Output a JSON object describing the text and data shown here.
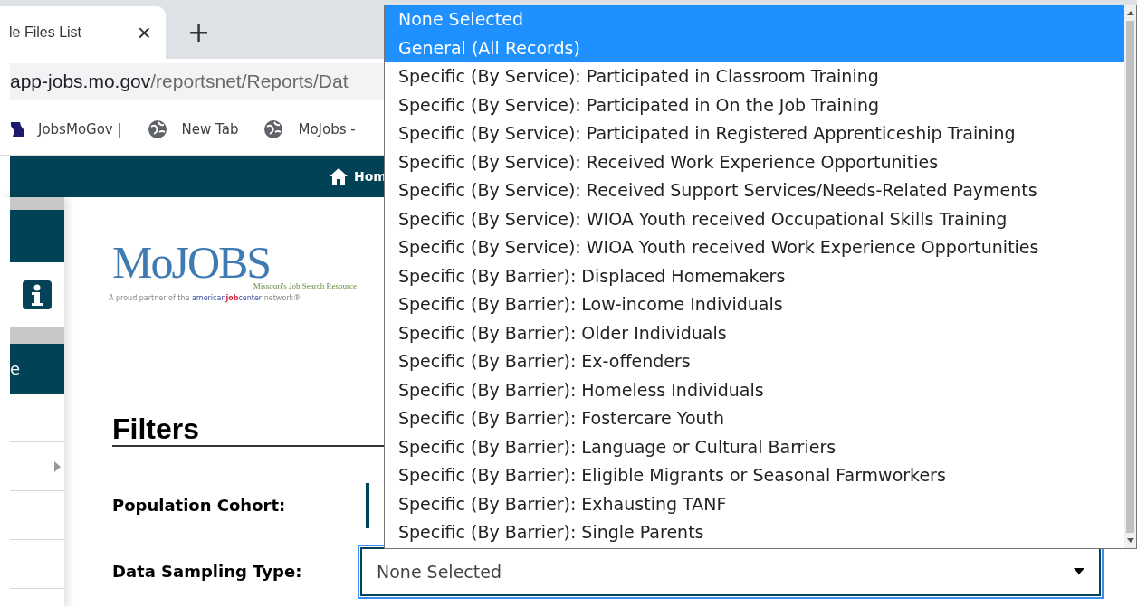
{
  "browser": {
    "tab": {
      "title": "le Files List",
      "close": "×"
    },
    "new_tab": "+",
    "address": {
      "host": "app-jobs.mo.gov",
      "path": "/reportsnet/Reports/Dat"
    },
    "bookmarks": [
      {
        "kind": "state",
        "label": "JobsMoGov |"
      },
      {
        "kind": "globe",
        "label": "New Tab"
      },
      {
        "kind": "globe",
        "label": "MoJobs -"
      }
    ]
  },
  "nav": {
    "home": "Hom"
  },
  "sidebar": {
    "item_label": "e"
  },
  "logo": {
    "name": "MoJOBS",
    "subtitle": "Missouri's Job Search Resource",
    "tagline": [
      "A proud partner of the ",
      "american",
      "job",
      "center",
      " network®"
    ]
  },
  "filters": {
    "title": "Filters",
    "fields": [
      {
        "label": "Population Cohort:"
      },
      {
        "label": "Data Sampling Type:",
        "value": "None Selected"
      }
    ]
  },
  "dropdown": {
    "options": [
      {
        "label": "None Selected",
        "selected": true
      },
      {
        "label": "General (All Records)",
        "selected": true
      },
      {
        "label": "Specific (By Service): Participated in Classroom Training",
        "selected": false
      },
      {
        "label": "Specific (By Service): Participated in On the Job Training",
        "selected": false
      },
      {
        "label": "Specific (By Service): Participated in Registered Apprenticeship Training",
        "selected": false
      },
      {
        "label": "Specific (By Service): Received Work Experience Opportunities",
        "selected": false
      },
      {
        "label": "Specific (By Service): Received Support Services/Needs-Related Payments",
        "selected": false
      },
      {
        "label": "Specific (By Service): WIOA Youth received Occupational Skills Training",
        "selected": false
      },
      {
        "label": "Specific (By Service): WIOA Youth received Work Experience Opportunities",
        "selected": false
      },
      {
        "label": "Specific (By Barrier): Displaced Homemakers",
        "selected": false
      },
      {
        "label": "Specific (By Barrier): Low-income Individuals",
        "selected": false
      },
      {
        "label": "Specific (By Barrier): Older Individuals",
        "selected": false
      },
      {
        "label": "Specific (By Barrier): Ex-offenders",
        "selected": false
      },
      {
        "label": "Specific (By Barrier): Homeless Individuals",
        "selected": false
      },
      {
        "label": "Specific (By Barrier): Fostercare Youth",
        "selected": false
      },
      {
        "label": "Specific (By Barrier): Language or Cultural Barriers",
        "selected": false
      },
      {
        "label": "Specific (By Barrier): Eligible Migrants or Seasonal Farmworkers",
        "selected": false
      },
      {
        "label": "Specific (By Barrier): Exhausting TANF",
        "selected": false
      },
      {
        "label": "Specific (By Barrier): Single Parents",
        "selected": false
      }
    ]
  }
}
